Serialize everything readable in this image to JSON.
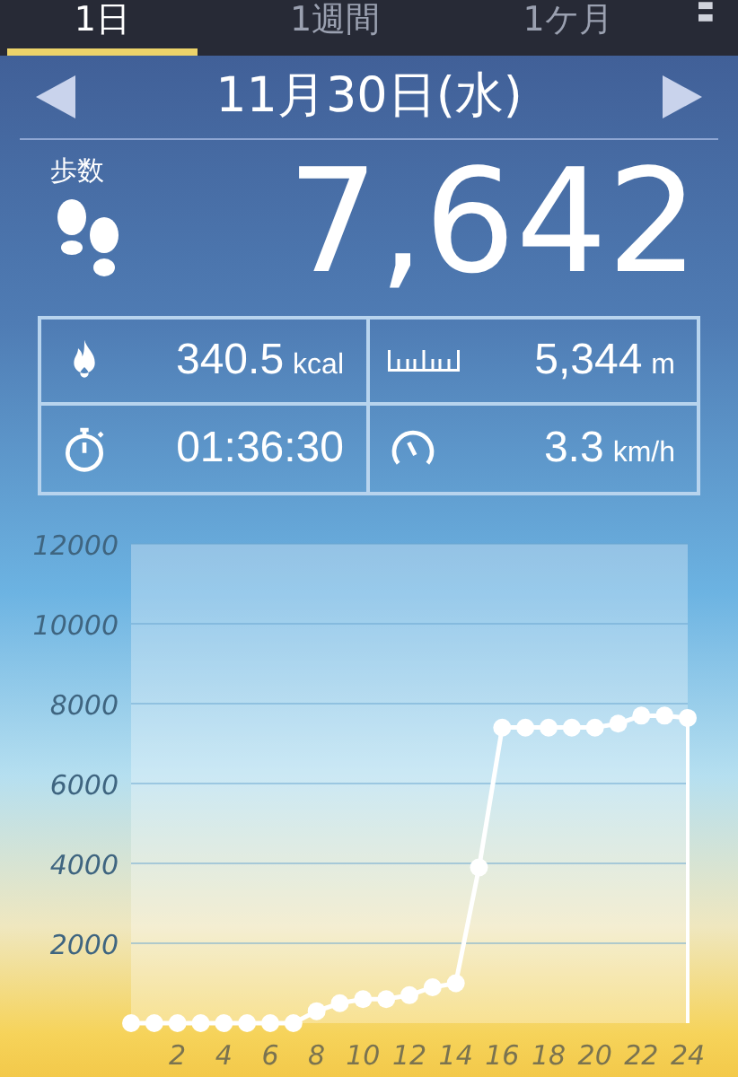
{
  "tabs": [
    {
      "label": "1日",
      "selected": true
    },
    {
      "label": "1週間",
      "selected": false
    },
    {
      "label": "1ケ月",
      "selected": false
    }
  ],
  "date": {
    "label": "11月30日(水)"
  },
  "steps": {
    "label": "歩数",
    "value": "7,642"
  },
  "stats": [
    {
      "kind": "calories",
      "value": "340.5",
      "unit": "kcal"
    },
    {
      "kind": "distance",
      "value": "5,344",
      "unit": "m"
    },
    {
      "kind": "time",
      "value": "01:36:30"
    },
    {
      "kind": "speed",
      "value": "3.3",
      "unit": "km/h"
    }
  ],
  "chart_data": {
    "type": "line",
    "x": [
      0,
      1,
      2,
      3,
      4,
      5,
      6,
      7,
      8,
      9,
      10,
      11,
      12,
      13,
      14,
      15,
      16,
      17,
      18,
      19,
      20,
      21,
      22,
      23,
      24
    ],
    "series": [
      {
        "color": "#ffffff",
        "marker": true,
        "values": [
          0,
          0,
          0,
          0,
          0,
          0,
          0,
          0,
          300,
          500,
          600,
          600,
          700,
          900,
          1000,
          3900,
          7400,
          7400,
          7400,
          7400,
          7400,
          7500,
          7700,
          7700,
          7642
        ]
      }
    ],
    "grid": true,
    "xlim": [
      0,
      24
    ],
    "ylim": [
      0,
      12000
    ],
    "xticks": [
      2,
      4,
      6,
      8,
      10,
      12,
      14,
      16,
      18,
      20,
      22,
      24
    ],
    "yticks": [
      2000,
      4000,
      6000,
      8000,
      10000,
      12000
    ]
  }
}
